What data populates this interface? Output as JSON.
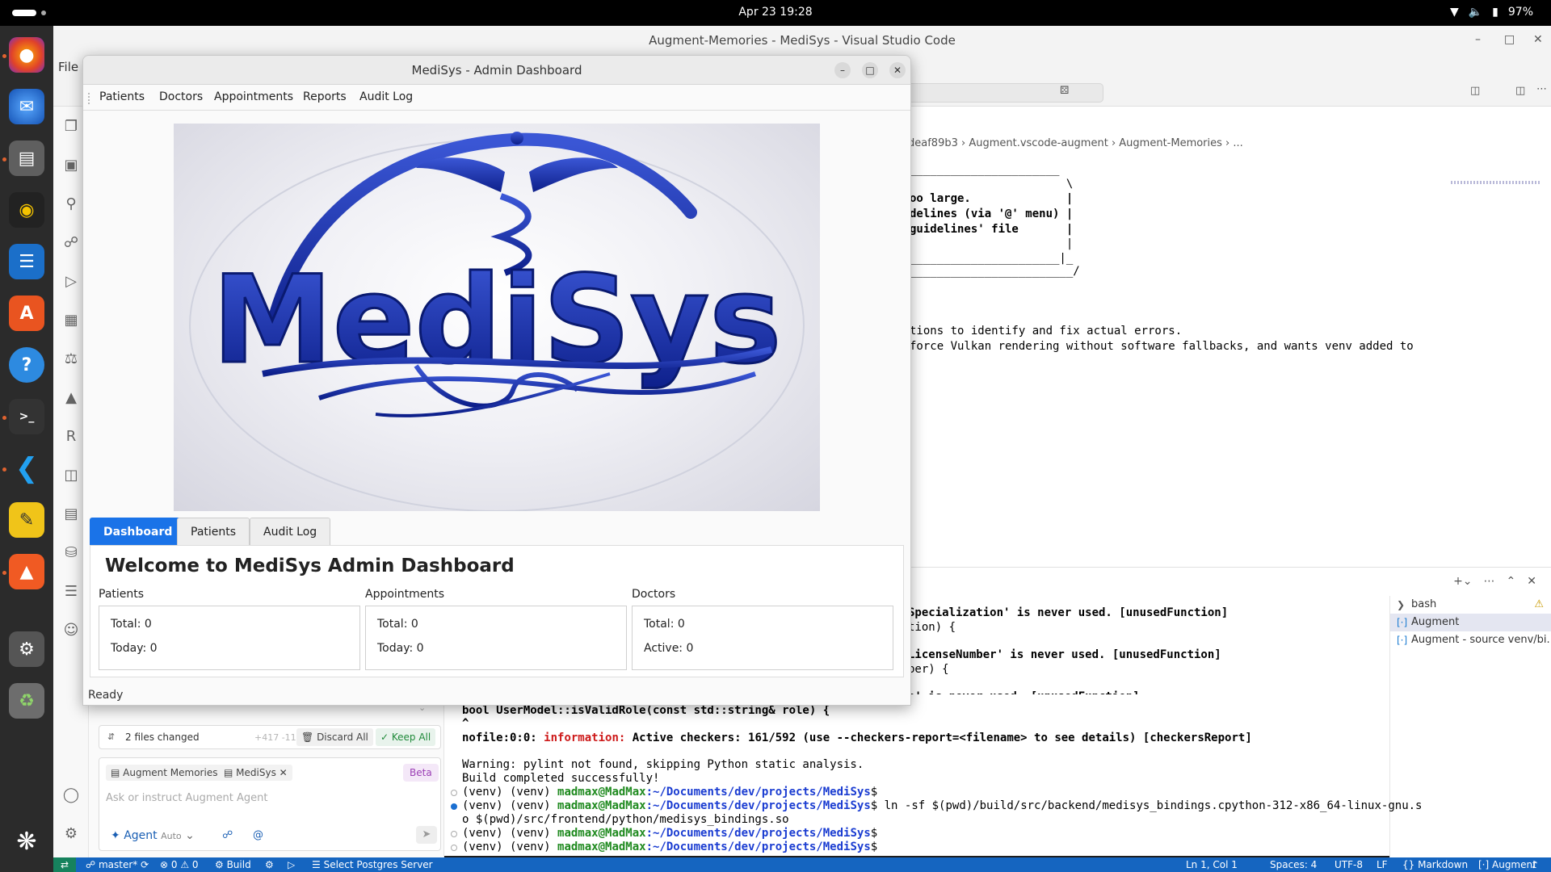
{
  "system": {
    "date_time": "Apr 23  19:28",
    "battery": "97%"
  },
  "vscode": {
    "window_title": "Augment-Memories - MediSys - Visual Studio Code",
    "menu_file": "File",
    "breadcrumb": [
      "deaf89b3",
      "Augment.vscode-augment",
      "Augment-Memories",
      "..."
    ],
    "editor_lines": [
      "______________________",
      "                       \\",
      "oo large.              |",
      "delines (via '@' menu) |",
      "guidelines' file       |",
      "                       |",
      "______________________|_",
      "________________________/",
      "tions to identify and fix actual errors.",
      "force Vulkan rendering without software fallbacks, and wants venv added to"
    ],
    "terminal_top": [
      "Specialization' is never used. [unusedFunction]",
      "tion) {",
      "LicenseNumber' is never used. [unusedFunction]",
      "ber) {",
      "e' is never used. [unusedFunction]"
    ],
    "terminal_list": [
      "bash",
      "Augment",
      "Augment - source venv/bi..."
    ],
    "terminal_main": {
      "line1": "bool UserModel::isValidRole(const std::string& role) {",
      "line2": "^",
      "info_prefix": "nofile:0:0: ",
      "info_label": "information:",
      "info_text": " Active checkers: 161/592 (use --checkers-report=<filename> to see details) [checkersReport]",
      "warn": "Warning: pylint not found, skipping Python static analysis.",
      "build": "Build completed successfully!",
      "prompt_venv": "(venv) (venv) ",
      "prompt_user": "madmax@MadMax",
      "prompt_path": ":~/Documents/dev/projects/MediSys",
      "prompt_dollar": "$",
      "ln_cmd": " ln -sf $(pwd)/build/src/backend/medisys_bindings.cpython-312-x86_64-linux-gnu.s",
      "ln_cont": "o $(pwd)/src/frontend/python/medisys_bindings.so"
    },
    "augment": {
      "files_changed": "2 files changed",
      "diff_stat": "+417 -11",
      "discard": "Discard All",
      "keep": "Keep All",
      "chip1": "Augment Memories",
      "chip2": "MediSys",
      "beta": "Beta",
      "placeholder": "Ask or instruct Augment Agent",
      "agent": "Agent",
      "auto": "Auto",
      "at": "@"
    },
    "statusbar": {
      "branch": "master*",
      "problems": "0",
      "warnings": "0",
      "build": "Build",
      "postgres": "Select Postgres Server",
      "position": "Ln 1, Col 1",
      "spaces": "Spaces: 4",
      "encoding": "UTF-8",
      "eol": "LF",
      "language": "Markdown",
      "augment": "Augment"
    }
  },
  "app": {
    "title": "MediSys - Admin Dashboard",
    "menu": [
      "Patients",
      "Doctors",
      "Appointments",
      "Reports",
      "Audit Log"
    ],
    "logo_text": "MediSys",
    "tabs": [
      "Dashboard",
      "Patients",
      "Audit Log"
    ],
    "welcome": "Welcome to MediSys Admin Dashboard",
    "groups": [
      {
        "title": "Patients",
        "line1": "Total: 0",
        "line2": "Today: 0"
      },
      {
        "title": "Appointments",
        "line1": "Total: 0",
        "line2": "Today: 0"
      },
      {
        "title": "Doctors",
        "line1": "Total: 0",
        "line2": "Active: 0"
      }
    ],
    "status": "Ready"
  }
}
